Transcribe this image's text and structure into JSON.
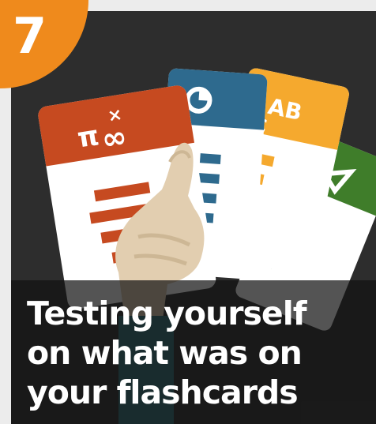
{
  "badge": {
    "number": "7",
    "color": "#ef8a1c"
  },
  "caption": {
    "lines": [
      "Testing yourself",
      "on what was on",
      "your flashcards"
    ]
  },
  "cards": [
    {
      "name": "math-card",
      "color": "#c64a20"
    },
    {
      "name": "chart-card",
      "color": "#2e6a8e"
    },
    {
      "name": "letters-card",
      "color": "#f5a92e"
    },
    {
      "name": "triangle-card",
      "color": "#3f7d2a"
    }
  ],
  "colors": {
    "frame": "#2d2d2d",
    "hand": "#e2ceb0",
    "sleeve": "#2d6f78"
  }
}
